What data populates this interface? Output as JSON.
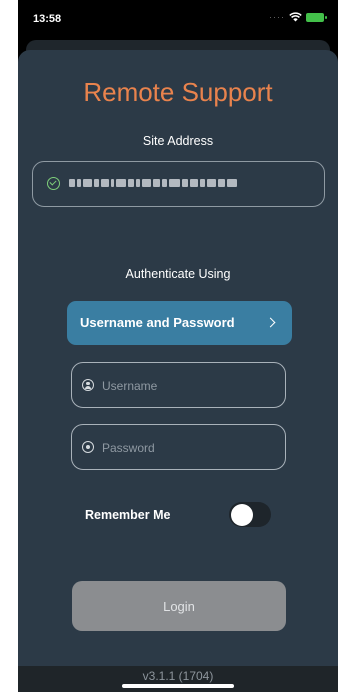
{
  "status_bar": {
    "time": "13:58",
    "signal_icon": "dots-signal",
    "wifi_icon": "wifi",
    "battery_icon": "battery-charging",
    "battery_color": "#43c04a"
  },
  "app": {
    "title": "Remote Support",
    "title_color": "#e9834d",
    "background_color": "#2c3a47"
  },
  "site_address": {
    "label": "Site Address",
    "status_icon": "check-circle",
    "status_color": "#7fd07a"
  },
  "authentication": {
    "label": "Authenticate Using",
    "method_button_label": "Username and Password",
    "method_button_color": "#3a7ea2",
    "chevron_icon": "chevron-right"
  },
  "fields": {
    "username_placeholder": "Username",
    "username_icon": "user",
    "password_placeholder": "Password",
    "password_icon": "lock"
  },
  "remember_me": {
    "label": "Remember Me",
    "enabled": false
  },
  "login": {
    "label": "Login",
    "enabled": false
  },
  "footer": {
    "version": "v3.1.1 (1704)"
  }
}
